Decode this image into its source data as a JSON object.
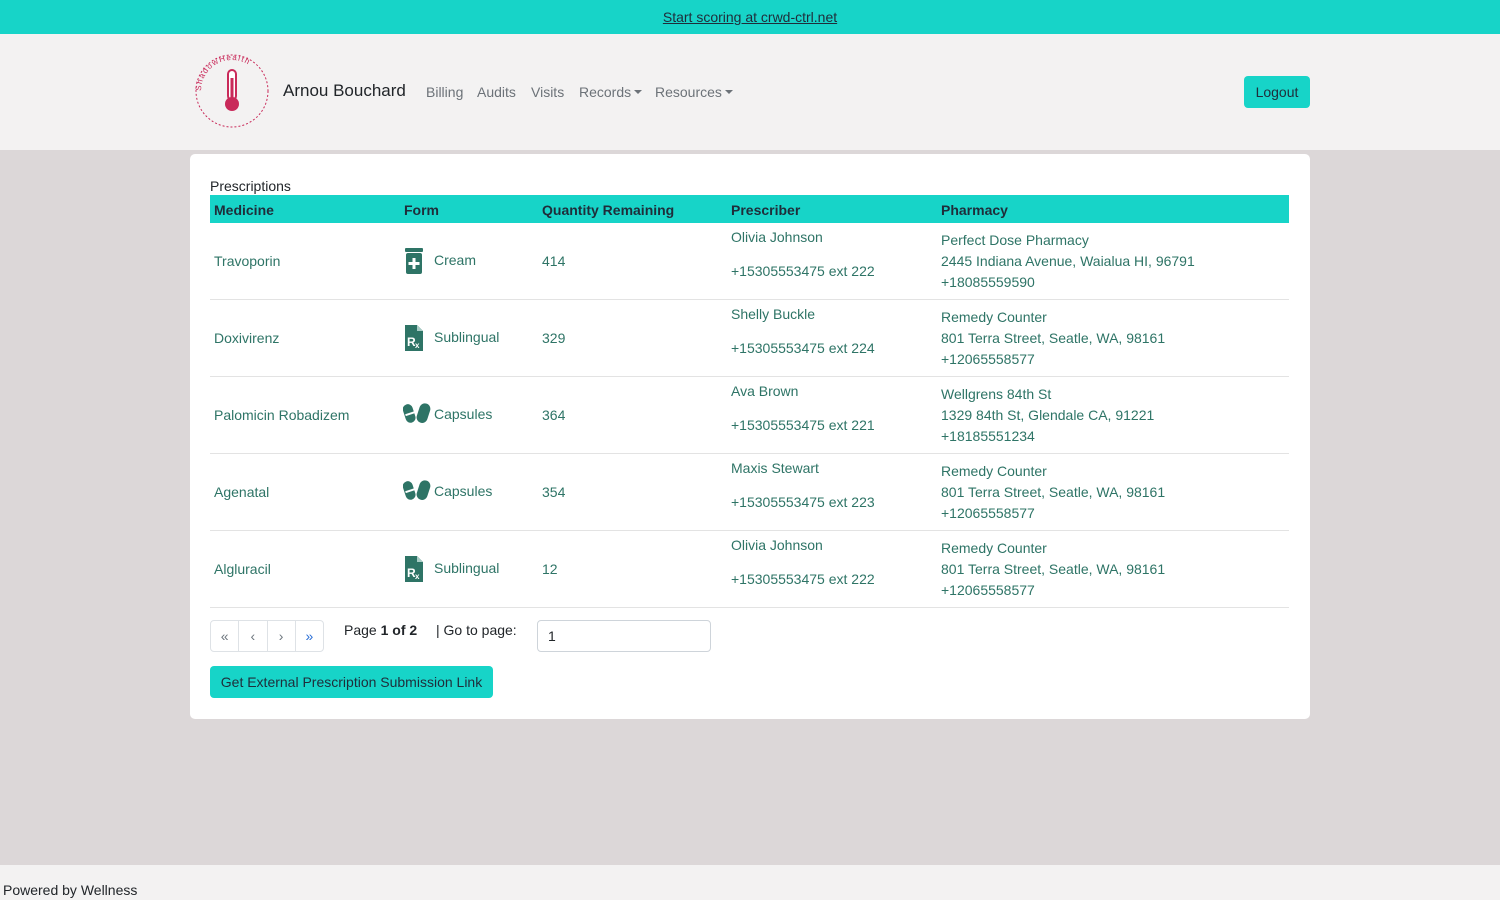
{
  "banner": {
    "text": "Start scoring at crwd-ctrl.net"
  },
  "nav": {
    "logo_text": "ShadowHealth",
    "brand": "Arnou Bouchard",
    "links": [
      "Billing",
      "Audits",
      "Visits",
      "Records",
      "Resources"
    ],
    "logout": "Logout"
  },
  "prescriptions": {
    "title": "Prescriptions",
    "headers": [
      "Medicine",
      "Form",
      "Quantity Remaining",
      "Prescriber",
      "Pharmacy"
    ],
    "rows": [
      {
        "medicine": "Travoporin",
        "form": "Cream",
        "form_icon": "cream-tube-icon",
        "quantity": "414",
        "prescriber_name": "Olivia Johnson",
        "prescriber_phone": "+15305553475 ext 222",
        "pharmacy_name": "Perfect Dose Pharmacy",
        "pharmacy_address": "2445 Indiana Avenue, Waialua HI, 96791",
        "pharmacy_phone": "+18085559590"
      },
      {
        "medicine": "Doxivirenz",
        "form": "Sublingual",
        "form_icon": "prescription-file-icon",
        "quantity": "329",
        "prescriber_name": "Shelly Buckle",
        "prescriber_phone": "+15305553475 ext 224",
        "pharmacy_name": "Remedy Counter",
        "pharmacy_address": "801 Terra Street, Seatle, WA, 98161",
        "pharmacy_phone": "+12065558577"
      },
      {
        "medicine": "Palomicin Robadizem",
        "form": "Capsules",
        "form_icon": "capsules-icon",
        "quantity": "364",
        "prescriber_name": "Ava Brown",
        "prescriber_phone": "+15305553475 ext 221",
        "pharmacy_name": "Wellgrens 84th St",
        "pharmacy_address": "1329 84th St, Glendale CA, 91221",
        "pharmacy_phone": "+18185551234"
      },
      {
        "medicine": "Agenatal",
        "form": "Capsules",
        "form_icon": "capsules-icon",
        "quantity": "354",
        "prescriber_name": "Maxis Stewart",
        "prescriber_phone": "+15305553475 ext 223",
        "pharmacy_name": "Remedy Counter",
        "pharmacy_address": "801 Terra Street, Seatle, WA, 98161",
        "pharmacy_phone": "+12065558577"
      },
      {
        "medicine": "Algluracil",
        "form": "Sublingual",
        "form_icon": "prescription-file-icon",
        "quantity": "12",
        "prescriber_name": "Olivia Johnson",
        "prescriber_phone": "+15305553475 ext 222",
        "pharmacy_name": "Remedy Counter",
        "pharmacy_address": "801 Terra Street, Seatle, WA, 98161",
        "pharmacy_phone": "+12065558577"
      }
    ]
  },
  "pagination": {
    "buttons": [
      "«",
      "‹",
      "›",
      "»"
    ],
    "page_prefix": "Page ",
    "page_of": "1 of 2",
    "goto_label": "| Go to page:",
    "goto_value": "1"
  },
  "external_button": "Get External Prescription Submission Link",
  "footer": "Powered by Wellness",
  "colors": {
    "accent": "#17d4c8",
    "link": "#2e7466",
    "background": "#dcd7d8"
  }
}
